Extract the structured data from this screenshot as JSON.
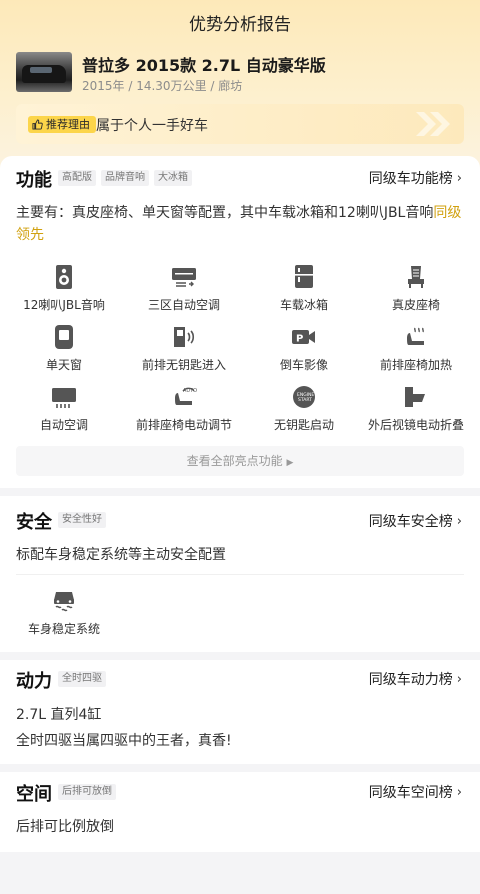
{
  "header": {
    "title": "优势分析报告"
  },
  "car": {
    "name": "普拉多 2015款 2.7L 自动豪华版",
    "meta": "2015年 / 14.30万公里 / 廊坊"
  },
  "reason": {
    "tag": "推荐理由",
    "text": "属于个人一手好车"
  },
  "function": {
    "title": "功能",
    "tags": [
      "高配版",
      "品牌音响",
      "大冰箱"
    ],
    "rank": "同级车功能榜",
    "desc_main": "主要有：真皮座椅、单天窗等配置，其中车载冰箱和12喇叭JBL音响",
    "desc_hl": "同级领先",
    "features": [
      {
        "label": "12喇叭JBL音响",
        "icon": "speaker-icon"
      },
      {
        "label": "三区自动空调",
        "icon": "ac-icon"
      },
      {
        "label": "车载冰箱",
        "icon": "fridge-icon"
      },
      {
        "label": "真皮座椅",
        "icon": "seat-icon"
      },
      {
        "label": "单天窗",
        "icon": "sunroof-icon"
      },
      {
        "label": "前排无钥匙进入",
        "icon": "keyless-entry-icon"
      },
      {
        "label": "倒车影像",
        "icon": "reverse-camera-icon"
      },
      {
        "label": "前排座椅加热",
        "icon": "seat-heating-icon"
      },
      {
        "label": "自动空调",
        "icon": "auto-ac-icon"
      },
      {
        "label": "前排座椅电动调节",
        "icon": "power-seat-icon"
      },
      {
        "label": "无钥匙启动",
        "icon": "keyless-start-icon"
      },
      {
        "label": "外后视镜电动折叠",
        "icon": "mirror-fold-icon"
      }
    ],
    "see_all": "查看全部亮点功能"
  },
  "safety": {
    "title": "安全",
    "tags": [
      "安全性好"
    ],
    "rank": "同级车安全榜",
    "desc": "标配车身稳定系统等主动安全配置",
    "features": [
      {
        "label": "车身稳定系统",
        "icon": "esp-icon"
      }
    ]
  },
  "power": {
    "title": "动力",
    "tags": [
      "全时四驱"
    ],
    "rank": "同级车动力榜",
    "line1": "2.7L 直列4缸",
    "line2": "全时四驱当属四驱中的王者，真香!"
  },
  "space": {
    "title": "空间",
    "tags": [
      "后排可放倒"
    ],
    "rank": "同级车空间榜",
    "desc": "后排可比例放倒"
  },
  "colors": {
    "accent": "#d1a10f",
    "tag_yellow": "#fcd54a",
    "hero": "#fde9b9"
  }
}
